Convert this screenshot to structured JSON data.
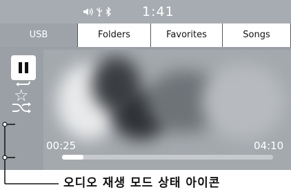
{
  "status": {
    "clock": "1:41",
    "icons": [
      "volume-icon",
      "usb-icon",
      "bluetooth-icon"
    ]
  },
  "tabs": [
    {
      "label": "USB",
      "active": true
    },
    {
      "label": "Folders",
      "active": false
    },
    {
      "label": "Favorites",
      "active": false
    },
    {
      "label": "Songs",
      "active": false
    }
  ],
  "controls": {
    "pause_icon": "pause-icon",
    "favorite_icon": "star-icon",
    "repeat_icon": "repeat-icon",
    "shuffle_icon": "shuffle-icon"
  },
  "playback": {
    "elapsed": "00:25",
    "total": "04:10",
    "progress_fraction": 0.1
  },
  "annotation": {
    "caption": "오디오 재생 모드 상태 아이콘"
  },
  "colors": {
    "accent": "#ffffff",
    "screen_bg": "#9aa0a6"
  }
}
